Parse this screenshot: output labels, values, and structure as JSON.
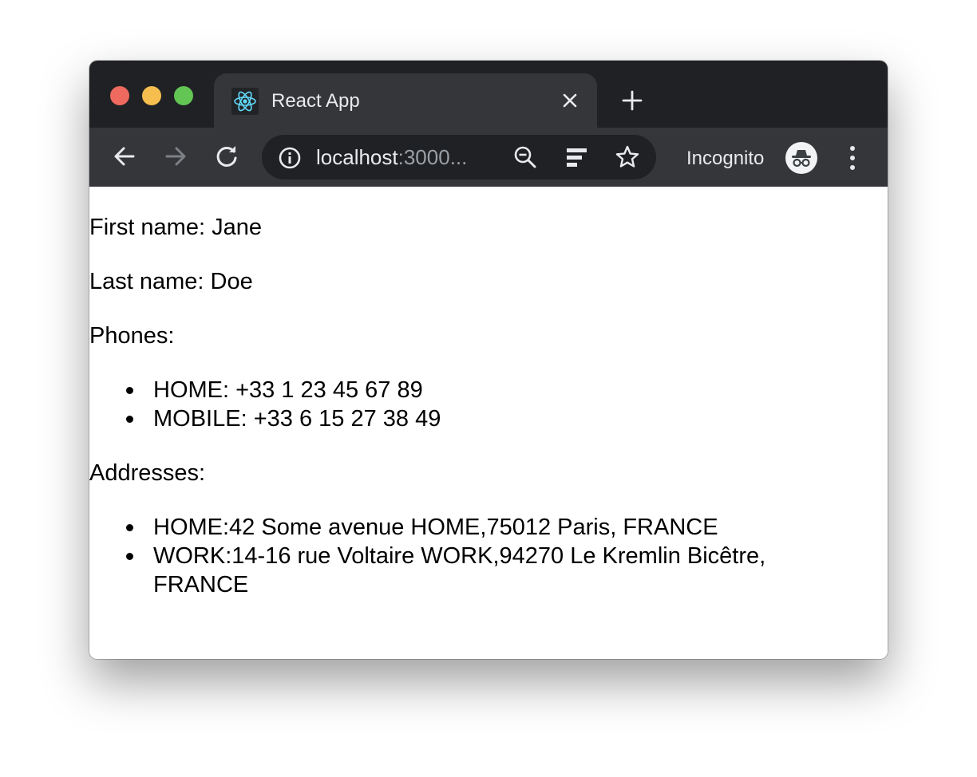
{
  "browser": {
    "tab_title": "React App",
    "url_host": "localhost",
    "url_port": ":3000...",
    "incognito_label": "Incognito",
    "colors": {
      "tabstrip": "#202124",
      "toolbar": "#35363a",
      "traffic_red": "#ee6a5e",
      "traffic_yellow": "#f5be4f",
      "traffic_green": "#62c554",
      "react_logo": "#61dafb"
    },
    "icons": [
      "react-logo-icon",
      "close-icon",
      "plus-icon",
      "back-arrow-icon",
      "forward-arrow-icon",
      "reload-icon",
      "info-icon",
      "zoom-out-icon",
      "reader-mode-icon",
      "star-icon",
      "incognito-icon",
      "more-vert-icon"
    ]
  },
  "page": {
    "first_name": "First name: Jane",
    "last_name": "Last name: Doe",
    "phones_heading": "Phones:",
    "phones": [
      "HOME: +33 1 23 45 67 89",
      "MOBILE: +33 6 15 27 38 49"
    ],
    "addresses_heading": "Addresses:",
    "addresses": [
      "HOME:42 Some avenue HOME,75012 Paris, FRANCE",
      "WORK:14-16 rue Voltaire WORK,94270 Le Kremlin Bicêtre, FRANCE"
    ]
  }
}
